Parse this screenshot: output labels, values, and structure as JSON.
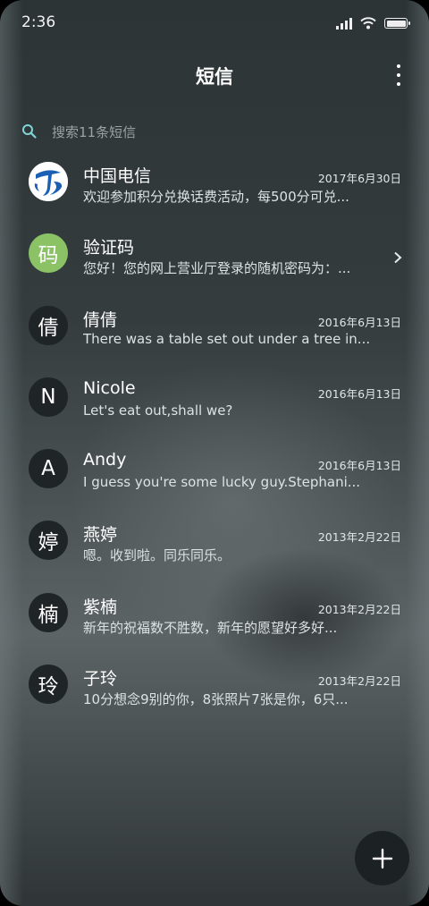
{
  "status_bar": {
    "time": "2:36"
  },
  "header": {
    "title": "短信"
  },
  "search": {
    "placeholder": "搜索11条短信"
  },
  "conversations": [
    {
      "name": "中国电信",
      "date": "2017年6月30日",
      "snippet": "欢迎参加积分兑换话费活动，每500分可兑...",
      "avatar": "china-telecom-logo"
    },
    {
      "name": "验证码",
      "date": "",
      "snippet": "您好！您的网上营业厅登录的随机密码为：...",
      "avatar_text": "码"
    },
    {
      "name": "倩倩",
      "date": "2016年6月13日",
      "snippet": "There was a table set out under a tree in...",
      "avatar_text": "倩"
    },
    {
      "name": "Nicole",
      "date": "2016年6月13日",
      "snippet": "Let's eat out,shall we?",
      "avatar_text": "N"
    },
    {
      "name": "Andy",
      "date": "2016年6月13日",
      "snippet": "I guess you're some lucky guy.Stephani...",
      "avatar_text": "A"
    },
    {
      "name": "燕婷",
      "date": "2013年2月22日",
      "snippet": "嗯。收到啦。同乐同乐。",
      "avatar_text": "婷"
    },
    {
      "name": "紫楠",
      "date": "2013年2月22日",
      "snippet": "新年的祝福数不胜数，新年的愿望好多好...",
      "avatar_text": "楠"
    },
    {
      "name": "子玲",
      "date": "2013年2月22日",
      "snippet": "10分想念9别的你，8张照片7张是你，6只...",
      "avatar_text": "玲"
    }
  ],
  "colors": {
    "verification_avatar": "#8cc266",
    "default_avatar": "#1f2426",
    "telecom_blue": "#1a5fb4"
  }
}
